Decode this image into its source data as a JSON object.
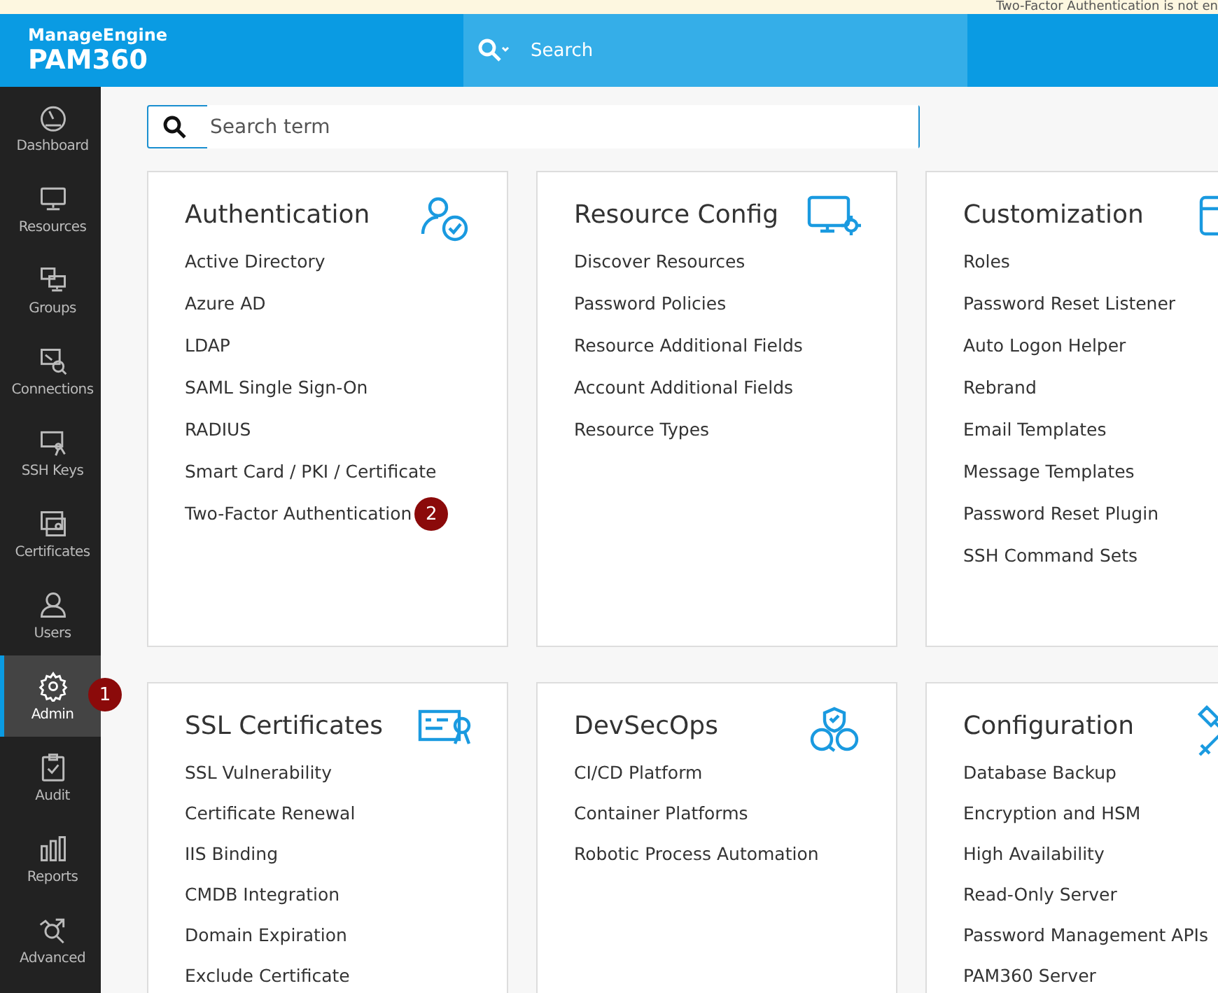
{
  "notice_banner": {
    "text": "Two-Factor Authentication is not en"
  },
  "header": {
    "brand": "ManageEngine",
    "product": "PAM360",
    "search": {
      "placeholder": "Search"
    }
  },
  "sidebar": {
    "items": [
      {
        "label": "Dashboard",
        "selected": false
      },
      {
        "label": "Resources",
        "selected": false
      },
      {
        "label": "Groups",
        "selected": false
      },
      {
        "label": "Connections",
        "selected": false
      },
      {
        "label": "SSH Keys",
        "selected": false
      },
      {
        "label": "Certificates",
        "selected": false
      },
      {
        "label": "Users",
        "selected": false
      },
      {
        "label": "Admin",
        "selected": true,
        "badge": "1"
      },
      {
        "label": "Audit",
        "selected": false
      },
      {
        "label": "Reports",
        "selected": false
      },
      {
        "label": "Advanced",
        "selected": false
      }
    ]
  },
  "search_field": {
    "placeholder": "Search term"
  },
  "cards": [
    {
      "title": "Authentication",
      "links": [
        {
          "label": "Active Directory"
        },
        {
          "label": "Azure AD"
        },
        {
          "label": "LDAP"
        },
        {
          "label": "SAML Single Sign-On"
        },
        {
          "label": "RADIUS"
        },
        {
          "label": "Smart Card / PKI / Certificate"
        },
        {
          "label": "Two-Factor Authentication",
          "badge": "2"
        }
      ]
    },
    {
      "title": "Resource Config",
      "links": [
        {
          "label": "Discover Resources"
        },
        {
          "label": "Password Policies"
        },
        {
          "label": "Resource Additional Fields"
        },
        {
          "label": "Account Additional Fields"
        },
        {
          "label": "Resource Types"
        }
      ]
    },
    {
      "title": "Customization",
      "links": [
        {
          "label": "Roles"
        },
        {
          "label": "Password Reset Listener"
        },
        {
          "label": "Auto Logon Helper"
        },
        {
          "label": "Rebrand"
        },
        {
          "label": "Email Templates"
        },
        {
          "label": "Message Templates"
        },
        {
          "label": "Password Reset Plugin"
        },
        {
          "label": "SSH Command Sets"
        }
      ]
    },
    {
      "title": "SSL Certificates",
      "links": [
        {
          "label": "SSL Vulnerability"
        },
        {
          "label": "Certificate Renewal"
        },
        {
          "label": "IIS Binding"
        },
        {
          "label": "CMDB Integration"
        },
        {
          "label": "Domain Expiration"
        },
        {
          "label": "Exclude Certificate"
        }
      ]
    },
    {
      "title": "DevSecOps",
      "links": [
        {
          "label": "CI/CD Platform"
        },
        {
          "label": "Container Platforms"
        },
        {
          "label": "Robotic Process Automation"
        }
      ]
    },
    {
      "title": "Configuration",
      "links": [
        {
          "label": "Database Backup"
        },
        {
          "label": "Encryption and HSM"
        },
        {
          "label": "High Availability"
        },
        {
          "label": "Read-Only Server"
        },
        {
          "label": "Password Management APIs"
        },
        {
          "label": "PAM360 Server"
        }
      ]
    }
  ]
}
